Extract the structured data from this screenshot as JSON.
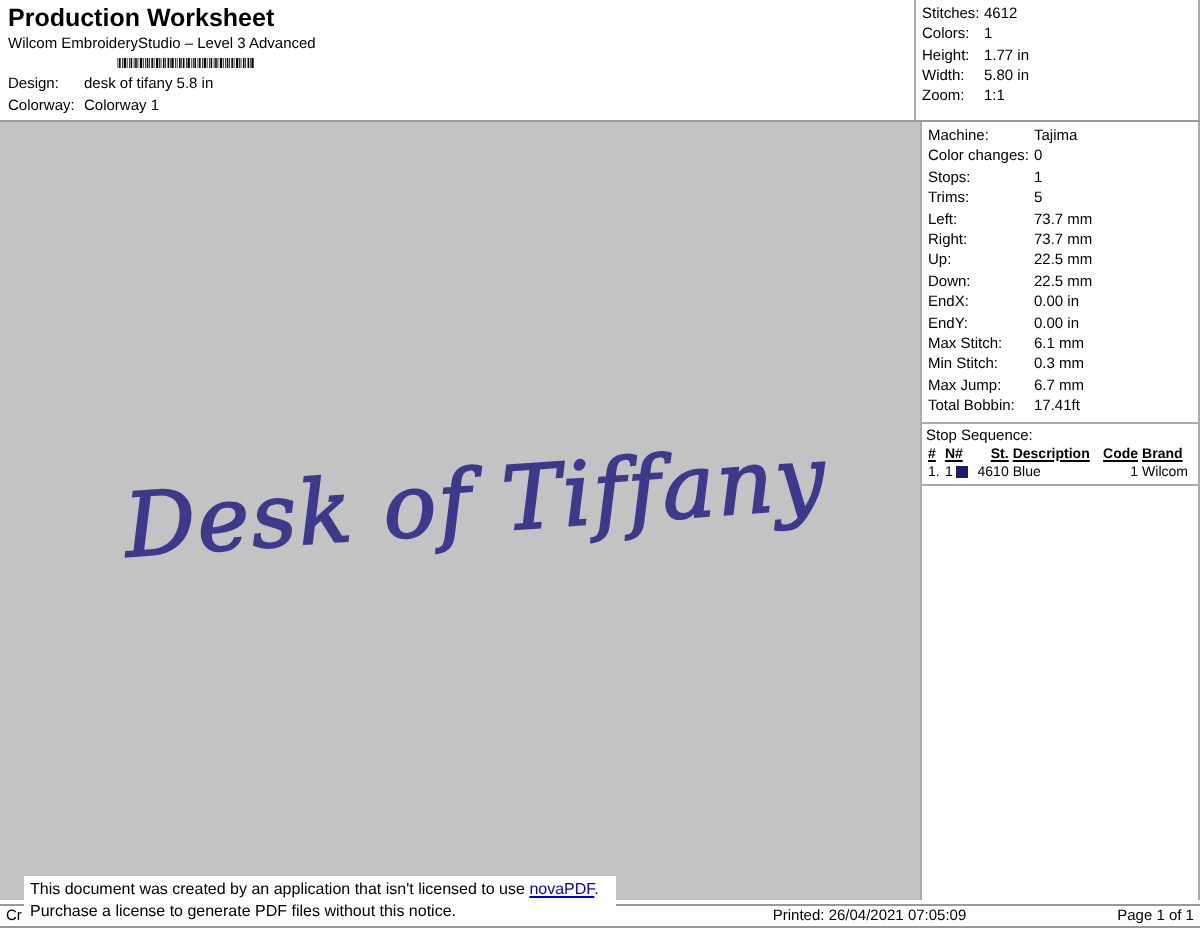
{
  "header": {
    "title": "Production Worksheet",
    "subtitle": "Wilcom EmbroideryStudio – Level 3 Advanced",
    "fields": [
      {
        "label": "Design:",
        "value": "desk of tifany 5.8 in"
      },
      {
        "label": "Colorway:",
        "value": "Colorway 1"
      }
    ]
  },
  "summary": [
    {
      "label": "Stitches:",
      "value": "4612"
    },
    {
      "label": "Colors:",
      "value": "1"
    },
    {
      "label": "Height:",
      "value": "1.77 in"
    },
    {
      "label": "Width:",
      "value": "5.80 in"
    },
    {
      "label": "Zoom:",
      "value": "1:1"
    }
  ],
  "design_preview": {
    "text": "Desk of Tiffany",
    "color": "#3d3a8c"
  },
  "details": [
    {
      "label": "Machine:",
      "value": "Tajima"
    },
    {
      "label": "Color changes:",
      "value": "0"
    },
    {
      "label": "Stops:",
      "value": "1"
    },
    {
      "label": "Trims:",
      "value": "5"
    },
    {
      "label": "Left:",
      "value": "73.7 mm"
    },
    {
      "label": "Right:",
      "value": "73.7 mm"
    },
    {
      "label": "Up:",
      "value": "22.5 mm"
    },
    {
      "label": "Down:",
      "value": "22.5 mm"
    },
    {
      "label": "EndX:",
      "value": "0.00 in"
    },
    {
      "label": "EndY:",
      "value": "0.00 in"
    },
    {
      "label": "Max Stitch:",
      "value": "6.1 mm"
    },
    {
      "label": "Min Stitch:",
      "value": "0.3 mm"
    },
    {
      "label": "Max Jump:",
      "value": "6.7 mm"
    },
    {
      "label": "Total Bobbin:",
      "value": "17.41ft"
    }
  ],
  "stop_sequence": {
    "title": "Stop Sequence:",
    "columns": [
      "#",
      "N#",
      "St.",
      "Description",
      "Code",
      "Brand"
    ],
    "rows": [
      {
        "index": "1.",
        "needle": "1",
        "color": "#1f1a72",
        "stitches": "4610",
        "description": "Blue",
        "code": "1",
        "brand": "Wilcom"
      }
    ]
  },
  "footer": {
    "left": "Cr",
    "printed": "Printed: 26/04/2021 07:05:09",
    "page": "Page 1 of 1"
  },
  "notice": {
    "line1": "This document was created by an application that isn't licensed to use",
    "link": "novaPDF",
    "line1_end": ".",
    "line2": "Purchase a license to generate PDF files without this notice."
  }
}
